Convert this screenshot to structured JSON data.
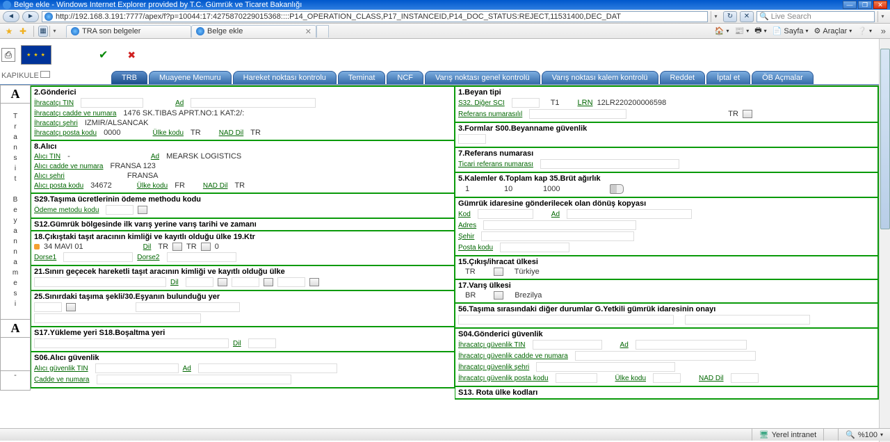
{
  "window": {
    "title": "Belge ekle - Windows Internet Explorer provided by T.C. Gümrük ve Ticaret Bakanlığı",
    "url": "http://192.168.3.191:7777/apex/f?p=10044:17:4275870229015368::::P14_OPERATION_CLASS,P17_INSTANCEID,P14_DOC_STATUS:REJECT,11531400,DEC_DAT",
    "search_placeholder": "Live Search"
  },
  "browser_tabs": {
    "tab1": "TRA son belgeler",
    "tab2": "Belge ekle"
  },
  "toolbar": {
    "sayfa": "Sayfa",
    "araclar": "Araçlar"
  },
  "kapikule": "KAPIKULE",
  "apptabs": {
    "trb": "TRB",
    "muayene": "Muayene Memuru",
    "hareket": "Hareket noktası kontrolu",
    "teminat": "Teminat",
    "ncf": "NCF",
    "varis_genel": "Varış noktası genel kontrolü",
    "varis_kalem": "Varış noktası kalem kontrolü",
    "reddet": "Reddet",
    "iptal": "İptal et",
    "ob": "ÖB Açmalar"
  },
  "sidetext": {
    "A": "A",
    "vert": "Transit Beyannamesi",
    "dash": "-"
  },
  "left": {
    "s2": {
      "title": "2.Gönderici",
      "ihr_tin": "İhracatçı TIN",
      "ad": "Ad",
      "cadde_lbl": "İhracatçı cadde ve numara",
      "cadde_val": "1476 SK.TIBAS APRT.NO:1 KAT:2/:",
      "sehir_lbl": "İhracatçı şehri",
      "sehir_val": "IZMIR/ALSANCAK",
      "posta_lbl": "İhracatçı posta kodu",
      "posta_val": "0000",
      "ulke_lbl": "Ülke   kodu",
      "ulke_val": "TR",
      "nad_lbl": "NAD   Dil",
      "nad_val": "TR"
    },
    "s8": {
      "title": "8.Alıcı",
      "tin_lbl": "Alıcı TIN",
      "tin_val": "-",
      "ad_lbl": "Ad",
      "ad_val": "MEARSK LOGISTICS",
      "cadde_lbl": "Alıcı cadde ve numara",
      "cadde_val": "FRANSA 123",
      "sehir_lbl": "Alıcı şehri",
      "sehir_val": "FRANSA",
      "posta_lbl": "Alıcı posta kodu",
      "posta_val": "34672",
      "ulke_lbl": "Ülke kodu",
      "ulke_val": "FR",
      "nad_lbl": "NAD Dil",
      "nad_val": "TR"
    },
    "s29": {
      "title": "S29.Taşıma ücretlerinin ödeme methodu kodu",
      "lbl": "Ödeme metodu kodu"
    },
    "s12": {
      "title": "S12.Gümrük bölgesinde ilk varış yerine varış tarihi ve zamanı"
    },
    "s18": {
      "title": "18.Çıkıştaki taşıt aracının kimliği ve kayıtlı olduğu ülke 19.Ktr",
      "val1": "34 MAVI 01",
      "dil": "Dil",
      "tr1": "TR",
      "tr2": "TR",
      "zero": "0",
      "dorse1": "Dorse1",
      "dorse2": "Dorse2"
    },
    "s21": {
      "title": "21.Sınırı geçecek hareketli taşıt aracının kimliği ve kayıtlı olduğu ülke",
      "dil": "Dil"
    },
    "s25": {
      "title": "25.Sınırdaki taşıma şekli/30.Eşyanın bulunduğu yer"
    },
    "s17": {
      "title": "S17.Yükleme yeri    S18.Boşaltma yeri",
      "dil": "Dil"
    },
    "s06": {
      "title": "S06.Alıcı güvenlik",
      "tin": "Alıcı güvenlik TIN",
      "ad": "Ad",
      "cadde": "Cadde ve numara"
    }
  },
  "right": {
    "s1": {
      "title": "1.Beyan tipi",
      "s32_lbl": "S32. Diğer SCI",
      "t1": "T1",
      "lrn_lbl": "LRN",
      "lrn_val": "12LR220200006598",
      "ref_lbl": "Referans numarasılıl",
      "tr": "TR"
    },
    "s3": {
      "title": "3.Formlar     S00.Beyanname güvenlik"
    },
    "s7": {
      "title": "7.Referans numarası",
      "lbl": "Ticari referans numarası"
    },
    "s5": {
      "title": "5.Kalemler      6.Toplam kap      35.Brüt ağırlık",
      "v1": "1",
      "v2": "10",
      "v3": "1000"
    },
    "gumruk": {
      "title": "Gümrük idaresine gönderilecek olan dönüş kopyası",
      "kod": "Kod",
      "ad": "Ad",
      "adres": "Adres",
      "sehir": "Şehir",
      "posta": "Posta kodu"
    },
    "s15": {
      "title": "15.Çıkış/ihracat ülkesi",
      "code": "TR",
      "name": "Türkiye"
    },
    "s17v": {
      "title": "17.Varış ülkesi",
      "code": "BR",
      "name": "Brezilya"
    },
    "s56": {
      "title": "56.Taşıma sırasındaki diğer durumlar G.Yetkili gümrük idaresinin onayı"
    },
    "s04": {
      "title": "S04.Gönderici güvenlik",
      "tin": "İhracatçı güvenlik TIN",
      "ad": "Ad",
      "cadde": "İhracatçı güvenlik cadde ve numara",
      "sehir": "İhracatçı güvenlik şehri",
      "posta": "İhracatçı güvenlik posta kodu",
      "ulke": "Ülke   kodu",
      "nad": "NAD   Dil"
    },
    "s13": {
      "title": "S13. Rota ülke kodları"
    }
  },
  "status": {
    "zone": "Yerel intranet",
    "zoom": "%100"
  }
}
